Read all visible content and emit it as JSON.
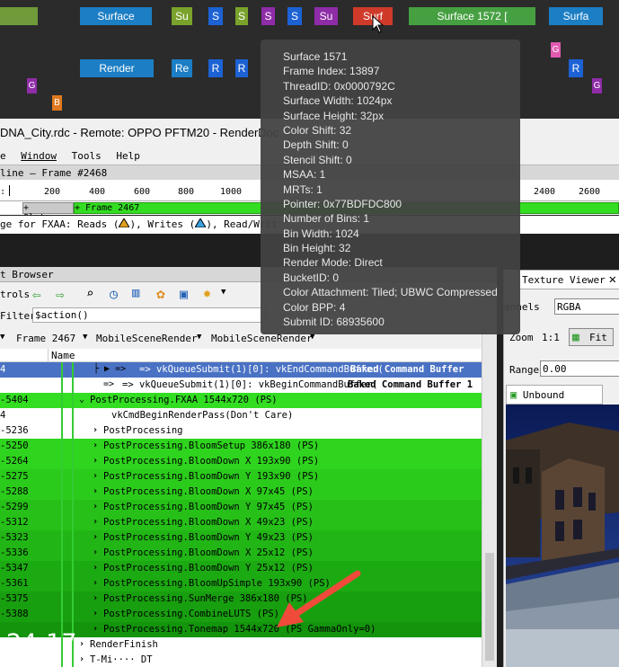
{
  "timeline": {
    "blocks_row1": [
      {
        "label": "Surface",
        "color": "#1c7ec4"
      },
      {
        "label": "Su",
        "color": "#7aa32c"
      },
      {
        "label": "S",
        "color": "#1c62d4"
      },
      {
        "label": "S",
        "color": "#7aa32c"
      },
      {
        "label": "S",
        "color": "#8f2ca8"
      },
      {
        "label": "S",
        "color": "#1c62d4"
      },
      {
        "label": "Su",
        "color": "#8f2ca8"
      },
      {
        "label": "Surf",
        "color": "#d03a2a"
      },
      {
        "label": "Surface 1572 [",
        "color": "#46a042"
      },
      {
        "label": "Surfa",
        "color": "#1c7ec4"
      }
    ],
    "blocks_row2": [
      {
        "label": "Render",
        "color": "#1c7ec4"
      },
      {
        "label": "Re",
        "color": "#1c7ec4"
      },
      {
        "label": "R",
        "color": "#1c62d4"
      },
      {
        "label": "R",
        "color": "#1c62d4"
      },
      {
        "label": "R",
        "color": "#1c62d4"
      }
    ],
    "small_blocks": [
      {
        "label": "G",
        "color": "#8f2ca8"
      },
      {
        "label": "B",
        "color": "#e07a1e"
      },
      {
        "label": "G",
        "color": "#e05ab0"
      },
      {
        "label": "R",
        "color": "#1c62d4"
      },
      {
        "label": "G",
        "color": "#8f2ca8"
      }
    ]
  },
  "window": {
    "title": "DNA_City.rdc - Remote: OPPO PFTM20 - RenderDoc",
    "menu": [
      "e",
      "Window",
      "Tools",
      "Help"
    ]
  },
  "timeline_panel": {
    "title": "line – Frame #2468",
    "ruler_start": ":",
    "ticks": [
      "200",
      "400",
      "600",
      "800",
      "1000",
      "2400",
      "2600"
    ],
    "slate_label": "+ Slate···",
    "frame_label": "+ Frame 2467",
    "usage_prefix": "ge for FXAA: Reads (",
    "usage_mid": "), Writes (",
    "usage_suffix": "), Read/Writ"
  },
  "tooltip": {
    "lines": [
      "Surface  1571",
      "Frame Index: 13897",
      "ThreadID: 0x0000792C",
      "Surface Width: 1024px",
      "Surface Height: 32px",
      "Color Shift: 32",
      "Depth Shift: 0",
      "Stencil Shift: 0",
      "MSAA: 1",
      "MRTs: 1",
      "Pointer: 0x77BDFDC800",
      "Number of Bins: 1",
      "Bin Width: 1024",
      "Bin Height: 32",
      "Render Mode: Direct",
      "BucketID: 0",
      "Color Attachment: Tiled; UBWC Compressed",
      "Color BPP: 4",
      "Submit ID: 68935600"
    ]
  },
  "event_browser": {
    "title": "t Browser",
    "controls_label": "trols",
    "filter_label": "Filter",
    "filter_value": "$action()",
    "breadcrumbs": [
      "Frame 2467",
      "MobileSceneRender",
      "MobileSceneRender"
    ],
    "column_name": "Name",
    "rows": [
      {
        "eid": "4",
        "text": "=>  vkQueueSubmit(1)[0]:  vkEndCommandBuffer(",
        "bold": "Baked Command Buffer",
        "style": "selected"
      },
      {
        "eid": "",
        "text": "=>  vkQueueSubmit(1)[0]:  vkBeginCommandBuffer(",
        "bold": "Baked Command Buffer 1",
        "style": "white"
      },
      {
        "eid": "-5404",
        "text": "PostProcessing.FXAA 1544x720 (PS)",
        "bold": "",
        "style": "bright"
      },
      {
        "eid": "4",
        "text": "vkCmdBeginRenderPass(Don't Care)",
        "bold": "",
        "style": "white"
      },
      {
        "eid": "-5236",
        "text": "PostProcessing",
        "bold": "",
        "style": "white"
      },
      {
        "eid": "-5250",
        "text": "PostProcessing.BloomSetup 386x180 (PS)",
        "bold": "",
        "style": "g1"
      },
      {
        "eid": "-5264",
        "text": "PostProcessing.BloomDown X 193x90 (PS)",
        "bold": "",
        "style": "g1"
      },
      {
        "eid": "-5275",
        "text": "PostProcessing.BloomDown Y 193x90 (PS)",
        "bold": "",
        "style": "g2"
      },
      {
        "eid": "-5288",
        "text": "PostProcessing.BloomDown X 97x45 (PS)",
        "bold": "",
        "style": "g2"
      },
      {
        "eid": "-5299",
        "text": "PostProcessing.BloomDown Y 97x45 (PS)",
        "bold": "",
        "style": "g3"
      },
      {
        "eid": "-5312",
        "text": "PostProcessing.BloomDown X 49x23 (PS)",
        "bold": "",
        "style": "g3"
      },
      {
        "eid": "-5323",
        "text": "PostProcessing.BloomDown Y 49x23 (PS)",
        "bold": "",
        "style": "g4"
      },
      {
        "eid": "-5336",
        "text": "PostProcessing.BloomDown X 25x12 (PS)",
        "bold": "",
        "style": "g4"
      },
      {
        "eid": "-5347",
        "text": "PostProcessing.BloomDown Y 25x12 (PS)",
        "bold": "",
        "style": "g5"
      },
      {
        "eid": "-5361",
        "text": "PostProcessing.BloomUpSimple 193x90 (PS)",
        "bold": "",
        "style": "g5"
      },
      {
        "eid": "-5375",
        "text": "PostProcessing.SunMerge 386x180 (PS)",
        "bold": "",
        "style": "g6"
      },
      {
        "eid": "-5388",
        "text": "PostProcessing.CombineLUTS (PS)",
        "bold": "",
        "style": "g6"
      },
      {
        "eid": "",
        "text": "PostProcessing.Tonemap 1544x720 (PS GammaOnly=0)",
        "bold": "",
        "style": "g7"
      },
      {
        "eid": "",
        "text": "RenderFinish",
        "bold": "",
        "style": "white"
      },
      {
        "eid": "",
        "text": "T-Mi···· DT",
        "bold": "",
        "style": "white"
      }
    ]
  },
  "texture_viewer": {
    "tab_label": "Texture Viewer",
    "channels_label": "annels",
    "channels_value": "RGBA",
    "zoom_label": "Zoom",
    "zoom_value": "1:1",
    "fit_label": "Fit",
    "range_label": "Range",
    "range_value": "0.00",
    "unbound_label": "Unbound"
  },
  "overlay": {
    "clock": "24-17"
  },
  "colors": {
    "bright_green": "#33dd22",
    "selected_row": "#4a72c4",
    "tooltip_bg": "#424242",
    "arrow": "#f04a3a"
  }
}
